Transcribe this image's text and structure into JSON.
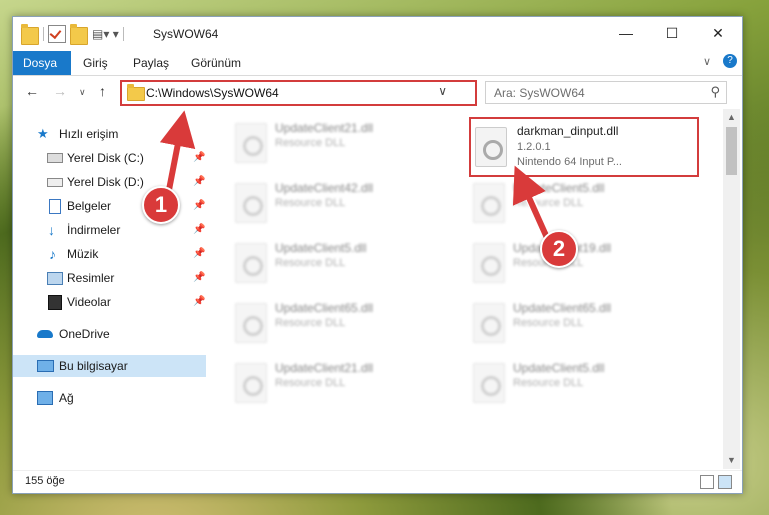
{
  "window": {
    "title": "SysWOW64"
  },
  "ribbon": {
    "tabs": [
      "Dosya",
      "Giriş",
      "Paylaş",
      "Görünüm"
    ]
  },
  "address": {
    "path": "C:\\Windows\\SysWOW64"
  },
  "search": {
    "placeholder": "Ara: SysWOW64"
  },
  "sidebar": {
    "items": [
      {
        "label": "Hızlı erişim",
        "icon": "star-icon"
      },
      {
        "label": "Yerel Disk (C:)",
        "icon": "drive-icon"
      },
      {
        "label": "Yerel Disk (D:)",
        "icon": "drive-icon"
      },
      {
        "label": "Belgeler",
        "icon": "documents-icon"
      },
      {
        "label": "İndirmeler",
        "icon": "download-icon"
      },
      {
        "label": "Müzik",
        "icon": "music-icon"
      },
      {
        "label": "Resimler",
        "icon": "pictures-icon"
      },
      {
        "label": "Videolar",
        "icon": "video-icon"
      },
      {
        "label": "OneDrive",
        "icon": "cloud-icon"
      },
      {
        "label": "Bu bilgisayar",
        "icon": "computer-icon"
      },
      {
        "label": "Ağ",
        "icon": "network-icon"
      }
    ]
  },
  "files": {
    "highlighted": {
      "name": "darkman_dinput.dll",
      "version": "1.2.0.1",
      "description": "Nintendo 64 Input P..."
    },
    "left": [
      {
        "name": "UpdateClient21.dll",
        "type": "Resource DLL"
      },
      {
        "name": "UpdateClient42.dll",
        "type": "Resource DLL"
      },
      {
        "name": "UpdateClient5.dll",
        "type": "Resource DLL"
      },
      {
        "name": "UpdateClient65.dll",
        "type": "Resource DLL"
      },
      {
        "name": "UpdateClient21.dll",
        "type": "Resource DLL"
      }
    ],
    "right": [
      {
        "name": "UpdateClient5.dll",
        "type": "Resource DLL"
      },
      {
        "name": "UpdateClient19.dll",
        "type": "Resource DLL"
      },
      {
        "name": "UpdateClient65.dll",
        "type": "Resource DLL"
      },
      {
        "name": "UpdateClient5.dll",
        "type": "Resource DLL"
      }
    ]
  },
  "status": {
    "count": "155 öğe"
  },
  "callouts": [
    "1",
    "2"
  ]
}
